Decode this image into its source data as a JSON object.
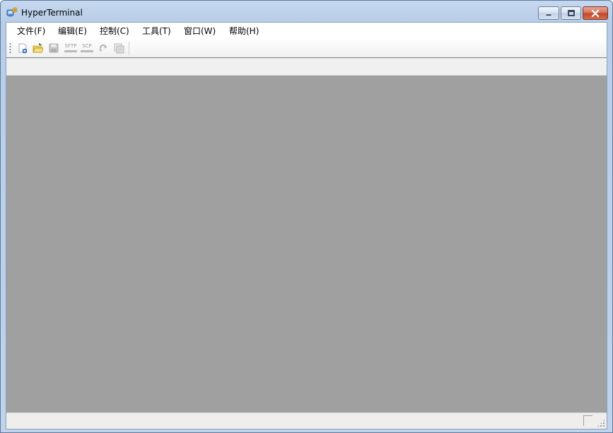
{
  "window": {
    "title": "HyperTerminal"
  },
  "menu": {
    "items": [
      {
        "label": "文件(F)"
      },
      {
        "label": "编辑(E)"
      },
      {
        "label": "控制(C)"
      },
      {
        "label": "工具(T)"
      },
      {
        "label": "窗口(W)"
      },
      {
        "label": "帮助(H)"
      }
    ]
  },
  "toolbar": {
    "sftp_label": "SFTP",
    "scp_label": "SCP",
    "icons": [
      "new-session-icon",
      "open-folder-icon",
      "save-icon",
      "sftp-icon",
      "scp-icon",
      "reconnect-icon",
      "copy-window-icon"
    ]
  },
  "colors": {
    "workspace": "#a0a0a0",
    "titlebar": "#c6d8ee",
    "close": "#c0442a"
  }
}
